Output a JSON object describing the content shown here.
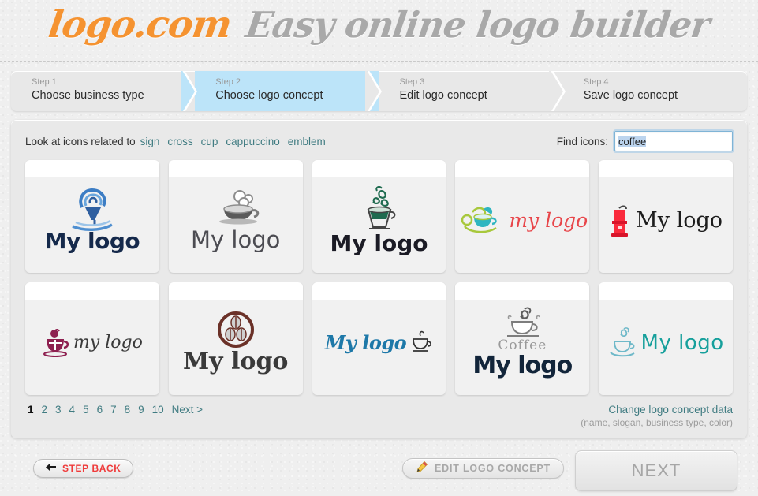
{
  "header": {
    "brand": "logo.com",
    "tagline": "Easy online logo builder",
    "brand_color": "#f59331",
    "tagline_color": "#a9a9a9"
  },
  "steps": {
    "active_index": 1,
    "items": [
      {
        "num": "Step 1",
        "label": "Choose business type"
      },
      {
        "num": "Step 2",
        "label": "Choose logo concept"
      },
      {
        "num": "Step 3",
        "label": "Edit logo concept"
      },
      {
        "num": "Step 4",
        "label": "Save logo concept"
      }
    ],
    "active_color": "#bce4f9"
  },
  "search": {
    "related_label": "Look at icons related to",
    "related_links": [
      "sign",
      "cross",
      "cup",
      "cappuccino",
      "emblem"
    ],
    "find_label": "Find icons:",
    "value": "coffee",
    "placeholder": "",
    "link_color": "#3f7b81"
  },
  "logos": [
    {
      "text": "My logo",
      "icon": "coffee-cup-swirl-icon",
      "color": "#15294b"
    },
    {
      "text": "My logo",
      "icon": "coffee-cup-foam-icon",
      "color": "#4c4c52"
    },
    {
      "text": "My logo",
      "icon": "coffee-cup-steam-green-icon",
      "color": "#1b1b25"
    },
    {
      "text": "my logo",
      "icon": "coffee-cup-teal-saucer-icon",
      "color": "#e8464a"
    },
    {
      "text": "My logo",
      "icon": "coffee-grinder-red-icon",
      "color": "#1d1d1d"
    },
    {
      "text": "my logo",
      "icon": "coffee-cup-purple-icon",
      "color": "#3a3a3a"
    },
    {
      "text": "My logo",
      "icon": "coffee-beans-circle-icon",
      "color": "#3a3a3a"
    },
    {
      "text": "My logo",
      "icon": "coffee-cup-outline-icon",
      "color": "#1d78a8"
    },
    {
      "text": "My logo",
      "subtext": "Coffee",
      "icon": "coffee-cup-sketch-icon",
      "color": "#12253a"
    },
    {
      "text": "My logo",
      "icon": "coffee-cup-teal-line-icon",
      "color": "#17a09c"
    }
  ],
  "pagination": {
    "pages": [
      "1",
      "2",
      "3",
      "4",
      "5",
      "6",
      "7",
      "8",
      "9",
      "10"
    ],
    "current": "1",
    "next_label": "Next >"
  },
  "change_concept": {
    "link": "Change logo concept data",
    "note": "(name, slogan, business type, color)"
  },
  "footer": {
    "step_back": "STEP BACK",
    "edit_concept": "EDIT LOGO CONCEPT",
    "next": "NEXT",
    "step_back_color": "#ef3b3b"
  }
}
